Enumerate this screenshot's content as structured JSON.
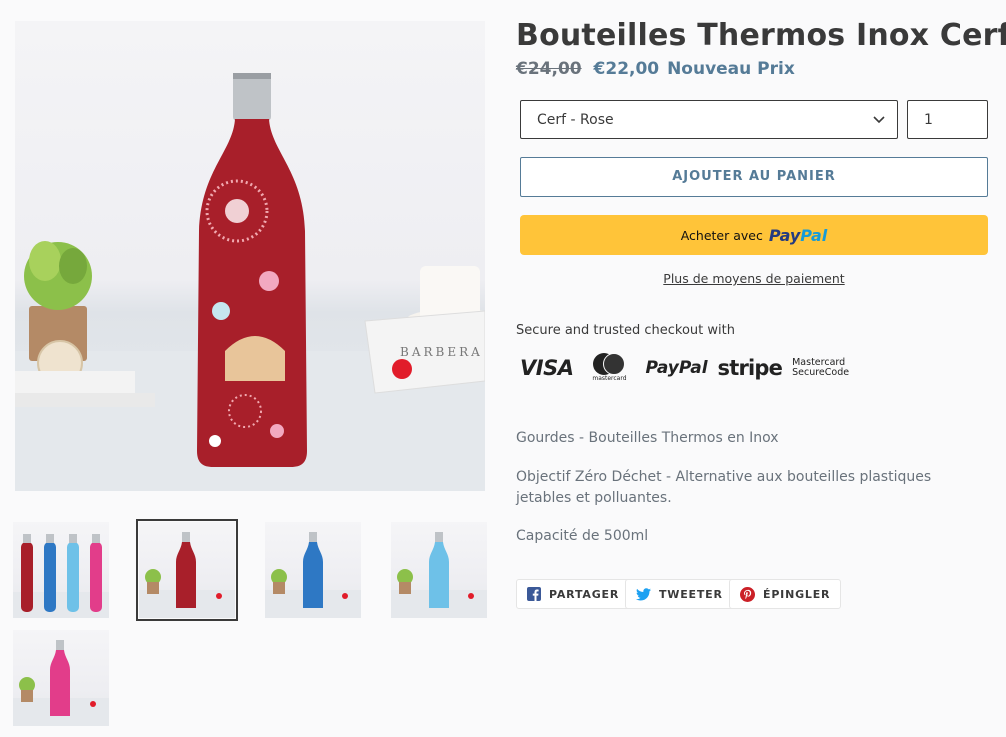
{
  "product": {
    "title": "Bouteilles Thermos Inox Cerf",
    "price_old": "€24,00",
    "price_new": "€22,00",
    "price_tag": "Nouveau Prix"
  },
  "variant_select": {
    "selected": "Cerf - Rose"
  },
  "quantity": {
    "value": "1"
  },
  "buttons": {
    "add_to_cart": "AJOUTER AU PANIER",
    "paypal_prefix": "Acheter avec",
    "paypal_brand_a": "Pay",
    "paypal_brand_b": "Pal",
    "more_payment": "Plus de moyens de paiement"
  },
  "secure": {
    "text": "Secure and trusted checkout with",
    "logos": [
      "VISA",
      "mastercard",
      "PayPal",
      "stripe",
      "Mastercard",
      "SecureCode"
    ]
  },
  "description": [
    "Gourdes - Bouteilles Thermos en Inox",
    "Objectif Zéro Déchet - Alternative aux bouteilles plastiques jetables et polluantes.",
    "Capacité de 500ml"
  ],
  "share": {
    "facebook": "PARTAGER",
    "twitter": "TWEETER",
    "pinterest": "ÉPINGLER"
  },
  "photo": {
    "packaging_text": "BARBERA"
  },
  "colors": {
    "accent": "#557b97",
    "paypal_yellow": "#ffc439",
    "bottle_red": "#a81f2a",
    "bottle_blue": "#2e78c4",
    "bottle_lightblue": "#6ec1e8",
    "bottle_pink": "#e23d8a"
  },
  "thumbnails": [
    {
      "label": "all-bottles"
    },
    {
      "label": "red-bottle",
      "active": true
    },
    {
      "label": "blue-bottle"
    },
    {
      "label": "lightblue-bottle"
    },
    {
      "label": "pink-bottle"
    }
  ]
}
